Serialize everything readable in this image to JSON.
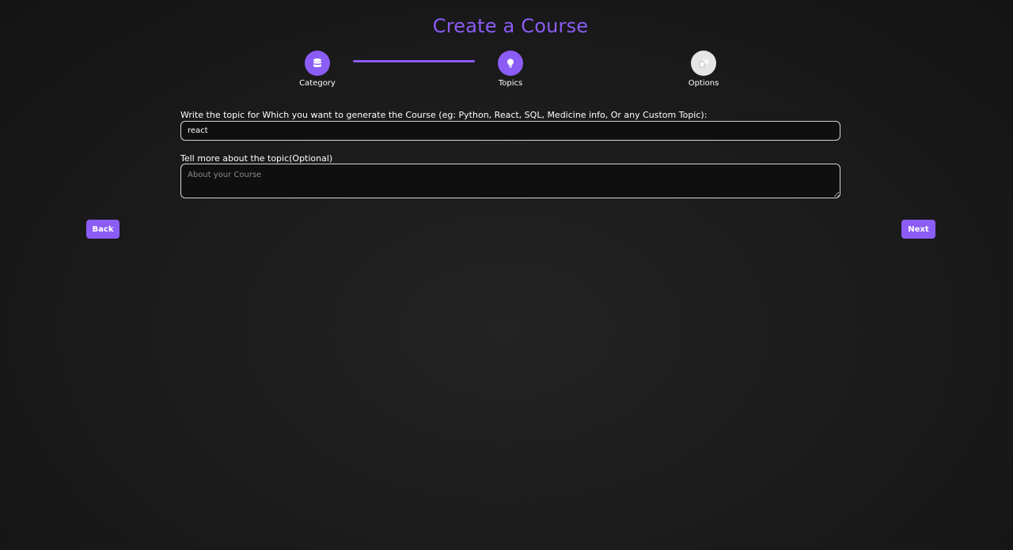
{
  "page": {
    "title": "Create a Course",
    "accent_color": "#8b5cf6"
  },
  "stepper": {
    "steps": [
      {
        "label": "Category",
        "icon": "database-icon",
        "state": "completed"
      },
      {
        "label": "Topics",
        "icon": "lightbulb-icon",
        "state": "active"
      },
      {
        "label": "Options",
        "icon": "options-icon",
        "state": "inactive"
      }
    ]
  },
  "form": {
    "topic_label": "Write the topic for Which you want to generate the Course (eg: Python, React, SQL, Medicine info, Or any Custom Topic):",
    "topic_value": "react",
    "description_label": "Tell more about the topic(Optional)",
    "description_placeholder": "About your Course",
    "description_value": ""
  },
  "nav": {
    "back_label": "Back",
    "next_label": "Next"
  }
}
